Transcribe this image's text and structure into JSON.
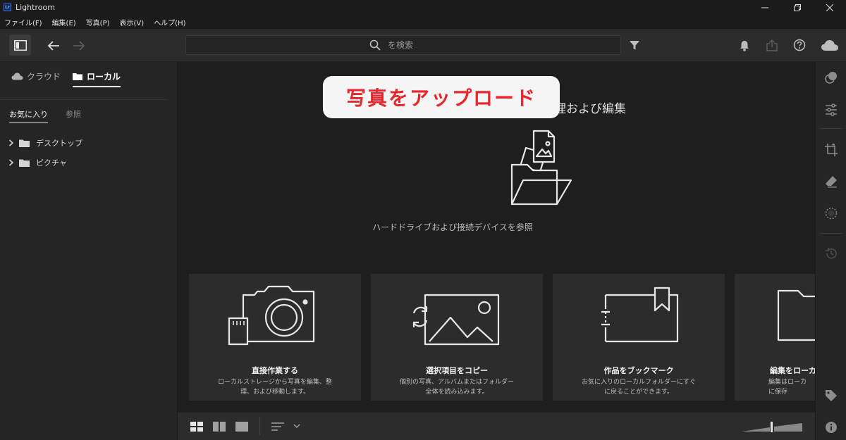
{
  "window": {
    "app_logo": "Lr",
    "title": "Lightroom"
  },
  "menu": [
    "ファイル(F)",
    "編集(E)",
    "写真(P)",
    "表示(V)",
    "ヘルプ(H)"
  ],
  "search": {
    "placeholder": "を検索"
  },
  "left_panel": {
    "tabs": [
      {
        "label": "クラウド",
        "icon": "cloud-icon",
        "active": false
      },
      {
        "label": "ローカル",
        "icon": "folder-icon",
        "active": true
      }
    ],
    "subtabs": [
      {
        "label": "お気に入り",
        "active": true
      },
      {
        "label": "参照",
        "active": false
      }
    ],
    "folders": [
      "デスクトップ",
      "ピクチャ"
    ]
  },
  "main": {
    "overlay_label": "写真をアップロード",
    "heading_visible_part": "理および編集",
    "browse_label": "ハードドライブおよび接続デバイスを参照",
    "cards": [
      {
        "icon": "camera-sdcard-icon",
        "title": "直接作業する",
        "desc": "ローカルストレージから写真を編集、整理、および移動します。"
      },
      {
        "icon": "image-sync-icon",
        "title": "選択項目をコピー",
        "desc": "個別の写真、アルバムまたはフォルダー全体を読み込みます。"
      },
      {
        "icon": "bookmark-album-icon",
        "title": "作品をブックマーク",
        "desc": "お気に入りのローカルフォルダーにすぐに戻ることができます。"
      },
      {
        "icon": "folder-icon",
        "title": "編集をローカ",
        "desc": "編集はローカ\nに保存"
      }
    ]
  },
  "colors": {
    "overlay_text": "#e8262c",
    "overlay_bg": "#f5f5f5",
    "panel_bg": "#252525",
    "main_bg": "#1e1e1e",
    "card_bg": "#2c2c2c"
  }
}
